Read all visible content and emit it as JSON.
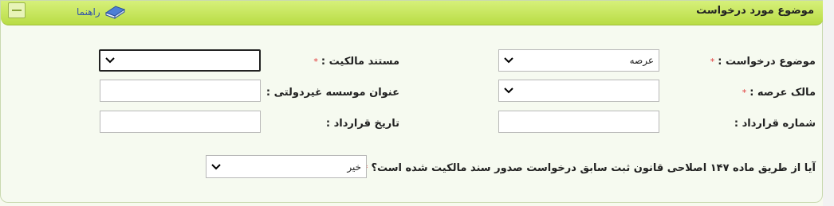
{
  "header": {
    "title": "موضوع مورد درخواست",
    "help_label": "راهنما"
  },
  "form": {
    "subject": {
      "label": "موضوع درخواست :",
      "value": "عرصه"
    },
    "ownership_doc": {
      "label": "مستند مالکیت :",
      "value": ""
    },
    "arsa_owner": {
      "label": "مالک عرصه :",
      "value": ""
    },
    "ngo_title": {
      "label": "عنوان موسسه غیردولتی :",
      "value": ""
    },
    "contract_number": {
      "label": "شماره قرارداد :",
      "value": ""
    },
    "contract_date": {
      "label": "تاریخ قرارداد :",
      "value": ""
    },
    "article_147": {
      "label": "آیا از طریق ماده ۱۴۷ اصلاحی قانون ثبت سابق درخواست صدور سند مالکیت شده است؟",
      "value": "خیر"
    }
  },
  "required_mark": "*"
}
